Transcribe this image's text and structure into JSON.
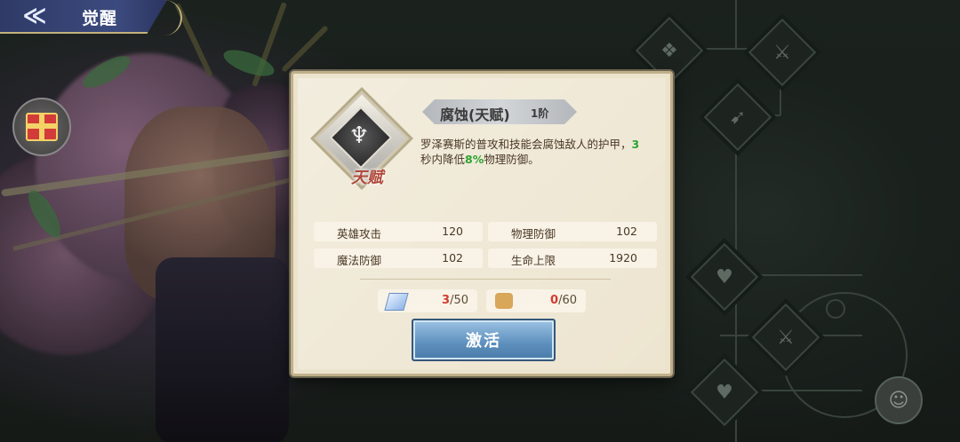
{
  "header": {
    "title": "觉醒",
    "back_icon": "back-arrow-icon"
  },
  "sidebar": {
    "gift_icon": "gift-icon"
  },
  "skill": {
    "name": "腐蚀(天赋)",
    "tier": "1阶",
    "icon": "wing-emblem-icon",
    "tag": "天赋",
    "desc_part1": "罗泽赛斯的普攻和技能会腐蚀敌人的护甲，",
    "desc_hl1": "3",
    "desc_part2": "秒内降低",
    "desc_hl2": "8%",
    "desc_part3": "物理防御。"
  },
  "stats": [
    {
      "label": "英雄攻击",
      "value": "120"
    },
    {
      "label": "物理防御",
      "value": "102"
    },
    {
      "label": "魔法防御",
      "value": "102"
    },
    {
      "label": "生命上限",
      "value": "1920"
    }
  ],
  "costs": [
    {
      "icon": "crystal-icon",
      "have": "3",
      "need": "/50"
    },
    {
      "icon": "puzzle-piece-icon",
      "have": "0",
      "need": "/60"
    }
  ],
  "actions": {
    "activate_label": "激活"
  },
  "colors": {
    "highlight_green": "#2ea331",
    "insufficient_red": "#d43a2f",
    "button_blue": "#5d8fbd",
    "panel_bg": "#ece3cd"
  }
}
